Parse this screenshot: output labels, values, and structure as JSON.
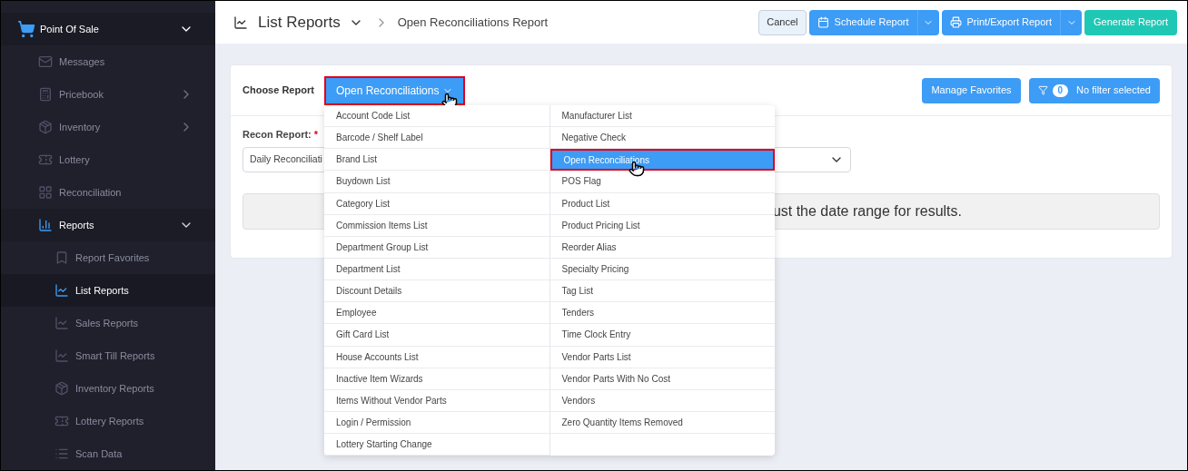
{
  "sidebar": {
    "section": {
      "label": "Point Of Sale",
      "expanded": true
    },
    "items": [
      {
        "label": "Messages",
        "selected": false
      },
      {
        "label": "Pricebook",
        "selected": false,
        "expanded": false
      },
      {
        "label": "Inventory",
        "selected": false,
        "expanded": false
      },
      {
        "label": "Lottery",
        "selected": false
      },
      {
        "label": "Reconciliation",
        "selected": false
      },
      {
        "label": "Reports",
        "selected": true,
        "expanded": true,
        "children": [
          {
            "label": "Report Favorites",
            "selected": false
          },
          {
            "label": "List Reports",
            "selected": true
          },
          {
            "label": "Sales Reports",
            "selected": false
          },
          {
            "label": "Smart Till Reports",
            "selected": false
          },
          {
            "label": "Inventory Reports",
            "selected": false
          },
          {
            "label": "Lottery Reports",
            "selected": false
          },
          {
            "label": "Scan Data",
            "selected": false
          }
        ]
      }
    ]
  },
  "header": {
    "title": "List Reports",
    "breadcrumb": "Open Reconciliations Report",
    "buttons": [
      {
        "label": "Cancel",
        "kind": "plain"
      },
      {
        "label": "Schedule Report",
        "kind": "split"
      },
      {
        "label": "Print/Export Report",
        "kind": "split"
      },
      {
        "label": "Generate Report",
        "kind": "primary"
      }
    ]
  },
  "card": {
    "choose_label": "Choose Report",
    "report_dropdown": {
      "value": "Open Reconciliations",
      "expanded": true
    },
    "manage_favorites": "Manage Favorites",
    "filter": {
      "count": "0",
      "label": "No filter selected"
    },
    "recon_label": "Recon Report:",
    "required_mark": "*",
    "recon_select": {
      "value": "Daily Reconciliati"
    },
    "notice": "ust the date range for results."
  },
  "menu": {
    "columns": [
      [
        {
          "label": "Account Code List",
          "selected": false
        },
        {
          "label": "Barcode / Shelf Label",
          "selected": false
        },
        {
          "label": "Brand List",
          "selected": false
        },
        {
          "label": "Buydown List",
          "selected": false
        },
        {
          "label": "Category List",
          "selected": false
        },
        {
          "label": "Commission Items List",
          "selected": false
        },
        {
          "label": "Department Group List",
          "selected": false
        },
        {
          "label": "Department List",
          "selected": false
        },
        {
          "label": "Discount Details",
          "selected": false
        },
        {
          "label": "Employee",
          "selected": false
        },
        {
          "label": "Gift Card List",
          "selected": false
        },
        {
          "label": "House Accounts List",
          "selected": false
        },
        {
          "label": "Inactive Item Wizards",
          "selected": false
        },
        {
          "label": "Items Without Vendor Parts",
          "selected": false
        },
        {
          "label": "Login / Permission",
          "selected": false
        },
        {
          "label": "Lottery Starting Change",
          "selected": false
        }
      ],
      [
        {
          "label": "Manufacturer List",
          "selected": false
        },
        {
          "label": "Negative Check",
          "selected": false
        },
        {
          "label": "Open Reconciliations",
          "selected": true
        },
        {
          "label": "POS Flag",
          "selected": false
        },
        {
          "label": "Product List",
          "selected": false
        },
        {
          "label": "Product Pricing List",
          "selected": false
        },
        {
          "label": "Reorder Alias",
          "selected": false
        },
        {
          "label": "Specialty Pricing",
          "selected": false
        },
        {
          "label": "Tag List",
          "selected": false
        },
        {
          "label": "Tenders",
          "selected": false
        },
        {
          "label": "Time Clock Entry",
          "selected": false
        },
        {
          "label": "Vendor Parts List",
          "selected": false
        },
        {
          "label": "Vendor Parts With No Cost",
          "selected": false
        },
        {
          "label": "Vendors",
          "selected": false
        },
        {
          "label": "Zero Quantity Items Removed",
          "selected": false
        }
      ]
    ]
  }
}
